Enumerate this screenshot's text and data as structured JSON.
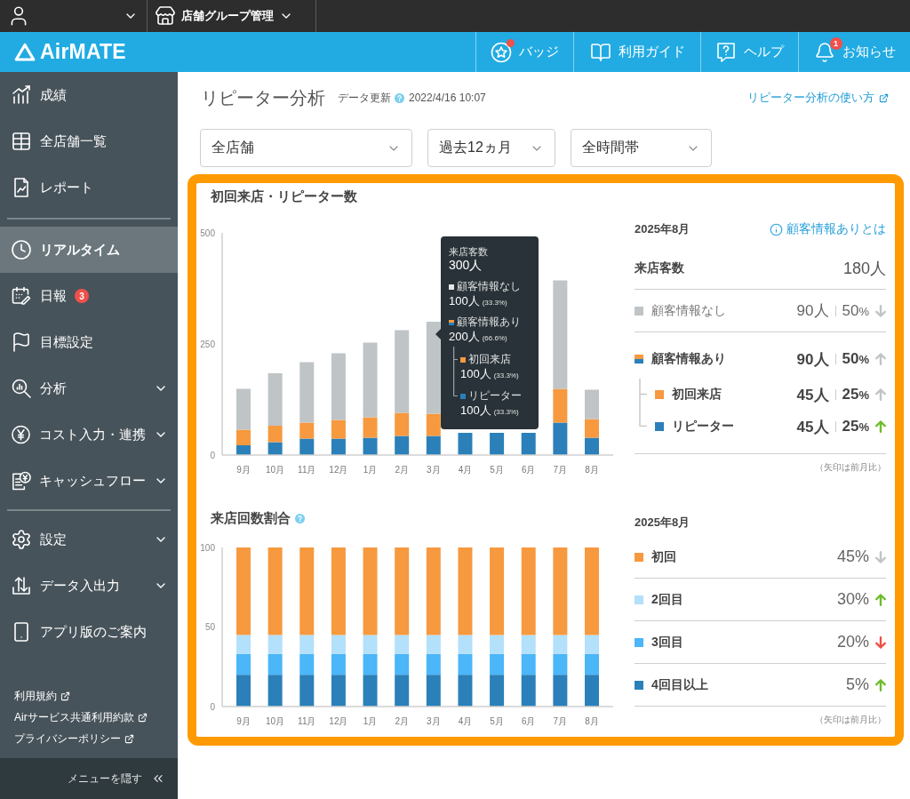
{
  "top_bar": {
    "store_menu": "店舗グループ管理"
  },
  "header": {
    "logo": "AirMATE",
    "nav": [
      {
        "label": "バッジ",
        "dot": true
      },
      {
        "label": "利用ガイド",
        "dot": false
      },
      {
        "label": "ヘルプ",
        "dot": false
      },
      {
        "label": "お知らせ",
        "dot": false,
        "badge": "1"
      }
    ]
  },
  "sidebar": {
    "groups": [
      {
        "items": [
          {
            "label": "成績",
            "selected": false,
            "expandable": false
          },
          {
            "label": "全店舗一覧",
            "selected": false,
            "expandable": false
          },
          {
            "label": "レポート",
            "selected": false,
            "expandable": false
          }
        ]
      },
      {
        "items": [
          {
            "label": "リアルタイム",
            "selected": true,
            "expandable": false
          },
          {
            "label": "日報",
            "selected": false,
            "expandable": false,
            "badge": "3"
          },
          {
            "label": "目標設定",
            "selected": false,
            "expandable": false
          },
          {
            "label": "分析",
            "selected": false,
            "expandable": true
          },
          {
            "label": "コスト入力・連携",
            "selected": false,
            "expandable": true
          },
          {
            "label": "キャッシュフロー",
            "selected": false,
            "expandable": true
          }
        ]
      },
      {
        "items": [
          {
            "label": "設定",
            "selected": false,
            "expandable": true
          },
          {
            "label": "データ入出力",
            "selected": false,
            "expandable": true
          },
          {
            "label": "アプリ版のご案内",
            "selected": false,
            "expandable": false
          }
        ]
      }
    ],
    "links": [
      "利用規約",
      "Airサービス共通利用約款",
      "プライバシーポリシー"
    ],
    "hide_menu": "メニューを隠す"
  },
  "page": {
    "title": "リピーター分析",
    "updated_label": "データ更新",
    "updated_at": "2022/4/16 10:07",
    "help_link": "リピーター分析の使い方",
    "filters": [
      {
        "value": "全店舗"
      },
      {
        "value": "過去12ヵ月"
      },
      {
        "value": "全時間帯"
      }
    ],
    "sections": [
      {
        "kind": "visitors",
        "title": "初回来店・リピーター数",
        "help": false,
        "chart_data": {
          "type": "bar",
          "stacked": true,
          "categories": [
            "9月",
            "10月",
            "11月",
            "12月",
            "1月",
            "2月",
            "3月",
            "4月",
            "5月",
            "6月",
            "7月",
            "8月"
          ],
          "ylim": [
            0,
            500
          ],
          "yticks": [
            0,
            250,
            500
          ],
          "series": [
            {
              "color": "#2b80b9",
              "values": [
                22,
                29,
                37,
                37,
                39,
                43,
                43,
                50,
                50,
                50,
                73,
                39
              ]
            },
            {
              "color": "#f7993f",
              "values": [
                35,
                37,
                36,
                42,
                46,
                52,
                50,
                null,
                null,
                null,
                76,
                42
              ]
            },
            {
              "color": "#bfc4c6",
              "values": [
                92,
                118,
                136,
                150,
                168,
                186,
                207,
                null,
                null,
                null,
                244,
                66
              ]
            }
          ]
        },
        "tooltip": {
          "title": "来店客数",
          "total": "300人",
          "items": [
            {
              "label": "顧客情報なし",
              "count": "100人",
              "share": "(33.3%)",
              "color": "#e6e6e6"
            },
            {
              "label": "顧客情報あり",
              "count": "200人",
              "share": "(66.6%)",
              "swatch_parts": [
                {
                  "color": "#f7993f"
                },
                {
                  "color": "#2b80b9"
                }
              ],
              "children": [
                {
                  "label": "初回来店",
                  "count": "100人",
                  "share": "(33.3%)",
                  "color": "#f7993f"
                },
                {
                  "label": "リピーター",
                  "count": "100人",
                  "share": "(33.3%)",
                  "color": "#2b80b9"
                }
              ]
            }
          ]
        },
        "summary": {
          "period": "2025年8月",
          "info_link": "顧客情報ありとは",
          "total": {
            "label": "来店客数",
            "value": "180人"
          },
          "rows": [
            {
              "label": "顧客情報なし",
              "count": "90人",
              "percent": "50%",
              "color": "#bfc4c6",
              "emphasized": false,
              "arrow": {
                "kind": "down",
                "color": "#bfc4c6"
              }
            },
            {
              "label": "顧客情報あり",
              "count": "90人",
              "percent": "50%",
              "swatch_parts": [
                {
                  "color": "#f7993f"
                },
                {
                  "color": "#2b80b9"
                }
              ],
              "emphasized": true,
              "arrow": {
                "kind": "up",
                "color": "#bfc4c6"
              },
              "children": [
                {
                  "label": "初回来店",
                  "count": "45人",
                  "percent": "25%",
                  "color": "#f7993f",
                  "emphasized": true,
                  "arrow": {
                    "kind": "up",
                    "color": "#bfc4c6"
                  }
                },
                {
                  "label": "リピーター",
                  "count": "45人",
                  "percent": "25%",
                  "color": "#2b80b9",
                  "emphasized": true,
                  "arrow": {
                    "kind": "up",
                    "color": "#6dbd2b"
                  }
                }
              ]
            }
          ],
          "note": "（矢印は前月比）"
        }
      },
      {
        "kind": "frequency",
        "title": "来店回数割合",
        "help": true,
        "chart_data": {
          "type": "bar",
          "stacked": true,
          "categories": [
            "9月",
            "10月",
            "11月",
            "12月",
            "1月",
            "2月",
            "3月",
            "4月",
            "5月",
            "6月",
            "7月",
            "8月"
          ],
          "ylim": [
            0,
            100
          ],
          "yticks": [
            0,
            50,
            100
          ],
          "series": [
            {
              "color": "#2b80b9",
              "values": [
                20,
                20,
                20,
                20,
                20,
                20,
                20,
                20,
                20,
                20,
                20,
                20
              ]
            },
            {
              "color": "#4bb6f8",
              "values": [
                13,
                13,
                13,
                13,
                13,
                13,
                13,
                13,
                13,
                13,
                13,
                13
              ]
            },
            {
              "color": "#b3e0fb",
              "values": [
                12,
                12,
                12,
                12,
                12,
                12,
                12,
                12,
                12,
                12,
                12,
                12
              ]
            },
            {
              "color": "#f7993f",
              "values": [
                55,
                55,
                55,
                55,
                55,
                55,
                55,
                55,
                55,
                55,
                55,
                55
              ]
            }
          ]
        },
        "summary": {
          "period": "2025年8月",
          "rows": [
            {
              "label": "初回",
              "percent": "45%",
              "color": "#f7993f",
              "emphasized": true,
              "arrow": {
                "kind": "down",
                "color": "#bfc4c6"
              }
            },
            {
              "label": "2回目",
              "percent": "30%",
              "color": "#b3e0fb",
              "emphasized": true,
              "arrow": {
                "kind": "up",
                "color": "#6dbd2b"
              }
            },
            {
              "label": "3回目",
              "percent": "20%",
              "color": "#4bb6f8",
              "emphasized": true,
              "arrow": {
                "kind": "down",
                "color": "#ef4f46"
              }
            },
            {
              "label": "4回目以上",
              "percent": "5%",
              "color": "#2b80b9",
              "emphasized": true,
              "arrow": {
                "kind": "up",
                "color": "#6dbd2b"
              }
            }
          ],
          "note": "（矢印は前月比）"
        }
      }
    ]
  }
}
